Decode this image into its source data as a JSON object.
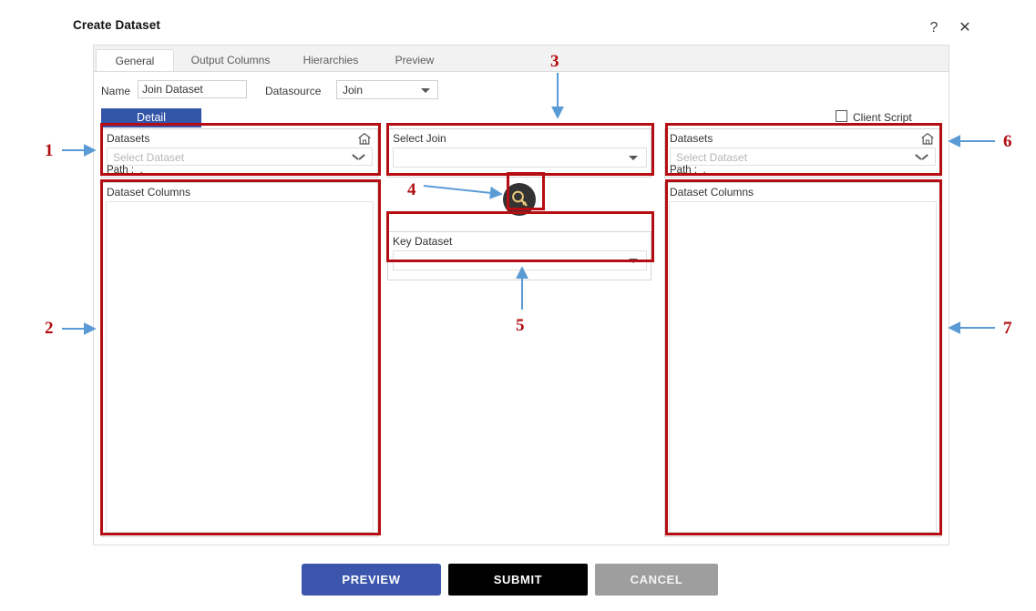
{
  "dialog": {
    "title": "Create Dataset",
    "help_icon": "question-mark-icon",
    "help_label": "?",
    "close_icon": "close-icon",
    "close_label": "✕"
  },
  "tabs": [
    {
      "label": "General",
      "active": true
    },
    {
      "label": "Output Columns",
      "active": false
    },
    {
      "label": "Hierarchies",
      "active": false
    },
    {
      "label": "Preview",
      "active": false
    }
  ],
  "form": {
    "name_label": "Name",
    "name_value": "Join Dataset",
    "name_placeholder": "",
    "datasource_label": "Datasource",
    "datasource_value": "Join",
    "detail_button": "Detail",
    "client_script_label": "Client Script",
    "client_script_checked": false
  },
  "left_panel": {
    "datasets_label": "Datasets",
    "home_icon": "home-icon",
    "select_placeholder": "Select Dataset",
    "path_label": "Path :",
    "path_value": ".",
    "columns_label": "Dataset Columns",
    "columns": []
  },
  "middle_panel": {
    "select_join_label": "Select Join",
    "select_join_value": "",
    "key_button_icon": "key-icon",
    "key_dataset_label": "Key Dataset",
    "key_dataset_value": ""
  },
  "right_panel": {
    "datasets_label": "Datasets",
    "home_icon": "home-icon",
    "select_placeholder": "Select Dataset",
    "path_label": "Path :",
    "path_value": ".",
    "columns_label": "Dataset Columns",
    "columns": []
  },
  "footer": {
    "preview": "PREVIEW",
    "submit": "SUBMIT",
    "cancel": "CANCEL"
  },
  "annotations": [
    {
      "number": "1",
      "target": "left-datasets-group"
    },
    {
      "number": "2",
      "target": "left-dataset-columns"
    },
    {
      "number": "3",
      "target": "select-join-group"
    },
    {
      "number": "4",
      "target": "key-button"
    },
    {
      "number": "5",
      "target": "key-dataset-group"
    },
    {
      "number": "6",
      "target": "right-datasets-group"
    },
    {
      "number": "7",
      "target": "right-dataset-columns"
    }
  ],
  "colors": {
    "annotation_red": "#b50d12",
    "annotation_arrow_blue": "#5b9bd5",
    "detail_blue": "#3355a8",
    "preview_blue": "#3c56ad",
    "submit_black": "#000000",
    "cancel_gray": "#9e9e9e",
    "key_button_dark": "#333333",
    "key_glyph_gold": "#e8c878"
  }
}
